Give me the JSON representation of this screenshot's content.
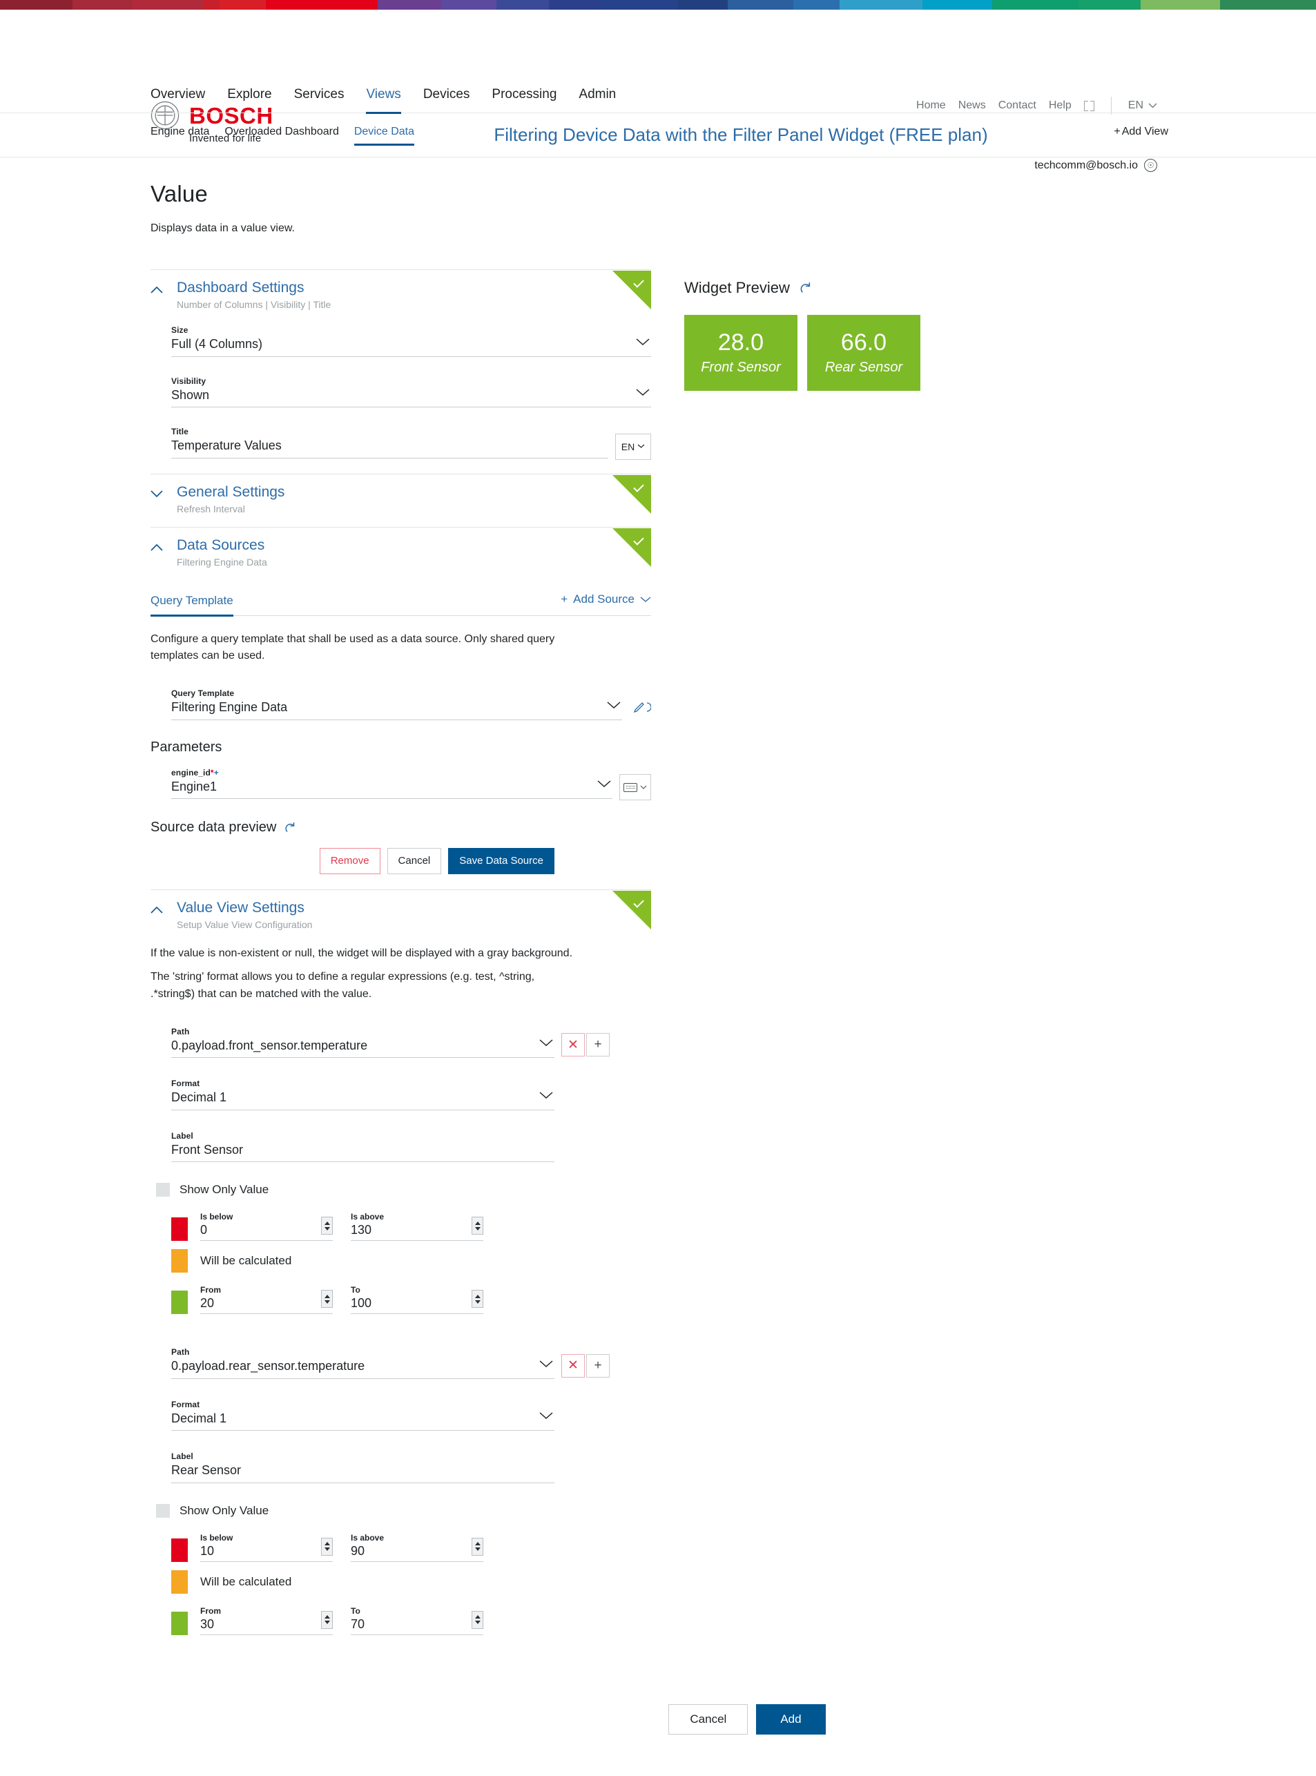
{
  "supergraphic": {
    "colors": [
      "#8c2230",
      "#a52a3a",
      "#b02a3c",
      "#c8202a",
      "#e2001a",
      "#e2001a",
      "#6b3f8f",
      "#5c4a9e",
      "#3b4a96",
      "#2b3f8c",
      "#25428a",
      "#22407f",
      "#2b5f9e",
      "#2c6fae",
      "#2f9fc9",
      "#30b5d6",
      "#00a0c8",
      "#0f9e6e",
      "#16a06a",
      "#7dba60",
      "#8cc06a",
      "#2e8b57",
      "#3b8f52"
    ]
  },
  "header": {
    "brand_name": "BOSCH",
    "brand_claim": "Invented for life",
    "page_title": "Filtering Device Data with the Filter Panel Widget (FREE plan)",
    "user_email": "techcomm@bosch.io",
    "utility_links": [
      "Home",
      "News",
      "Contact",
      "Help"
    ],
    "language": "EN"
  },
  "main_nav": {
    "items": [
      "Overview",
      "Explore",
      "Services",
      "Views",
      "Devices",
      "Processing",
      "Admin"
    ],
    "active": "Views"
  },
  "sub_nav": {
    "items": [
      "Engine data",
      "Overloaded Dashboard",
      "Device Data"
    ],
    "active": "Device Data",
    "add_view_label": "Add View"
  },
  "page": {
    "title": "Value",
    "description": "Displays data in a value view."
  },
  "dashboard_settings": {
    "title": "Dashboard Settings",
    "subtitle": "Number of Columns | Visibility | Title",
    "size": {
      "label": "Size",
      "value": "Full (4 Columns)"
    },
    "visibility": {
      "label": "Visibility",
      "value": "Shown"
    },
    "title_field": {
      "label": "Title",
      "value": "Temperature Values",
      "lang": "EN"
    }
  },
  "general_settings": {
    "title": "General Settings",
    "subtitle": "Refresh Interval"
  },
  "data_sources": {
    "title": "Data Sources",
    "subtitle": "Filtering Engine Data",
    "tab_label": "Query Template",
    "add_source_label": "Add Source",
    "help_text": "Configure a query template that shall be used as a data source. Only shared query templates can be used.",
    "query_template": {
      "label": "Query Template",
      "value": "Filtering Engine Data"
    },
    "parameters_heading": "Parameters",
    "parameter": {
      "label": "engine_id",
      "value": "Engine1"
    },
    "preview_heading": "Source data preview",
    "buttons": {
      "remove": "Remove",
      "cancel": "Cancel",
      "save": "Save Data Source"
    }
  },
  "value_view_settings": {
    "title": "Value View Settings",
    "subtitle": "Setup Value View Configuration",
    "help_line_1": "If the value is non-existent or null, the widget will be displayed with a gray background.",
    "help_line_2": "The 'string' format allows you to define a regular expressions (e.g. test, ^string, .*string$) that can be matched with the value.",
    "entries": [
      {
        "path": {
          "label": "Path",
          "value": "0.payload.front_sensor.temperature"
        },
        "format": {
          "label": "Format",
          "value": "Decimal 1"
        },
        "label_field": {
          "label": "Label",
          "value": "Front Sensor"
        },
        "show_only_value": "Show Only Value",
        "red": {
          "below_label": "Is below",
          "below_value": "0",
          "above_label": "Is above",
          "above_value": "130",
          "color": "#e2001a"
        },
        "orange": {
          "text": "Will be calculated",
          "color": "#f5a623"
        },
        "green": {
          "from_label": "From",
          "from_value": "20",
          "to_label": "To",
          "to_value": "100",
          "color": "#7dba28"
        }
      },
      {
        "path": {
          "label": "Path",
          "value": "0.payload.rear_sensor.temperature"
        },
        "format": {
          "label": "Format",
          "value": "Decimal 1"
        },
        "label_field": {
          "label": "Label",
          "value": "Rear Sensor"
        },
        "show_only_value": "Show Only Value",
        "red": {
          "below_label": "Is below",
          "below_value": "10",
          "above_label": "Is above",
          "above_value": "90",
          "color": "#e2001a"
        },
        "orange": {
          "text": "Will be calculated",
          "color": "#f5a623"
        },
        "green": {
          "from_label": "From",
          "from_value": "30",
          "to_label": "To",
          "to_value": "70",
          "color": "#7dba28"
        }
      }
    ]
  },
  "widget_preview": {
    "title": "Widget Preview",
    "tiles": [
      {
        "value": "28.0",
        "label": "Front Sensor",
        "color": "#7dba28"
      },
      {
        "value": "66.0",
        "label": "Rear Sensor",
        "color": "#7dba28"
      }
    ]
  },
  "footer": {
    "cancel": "Cancel",
    "add": "Add"
  }
}
